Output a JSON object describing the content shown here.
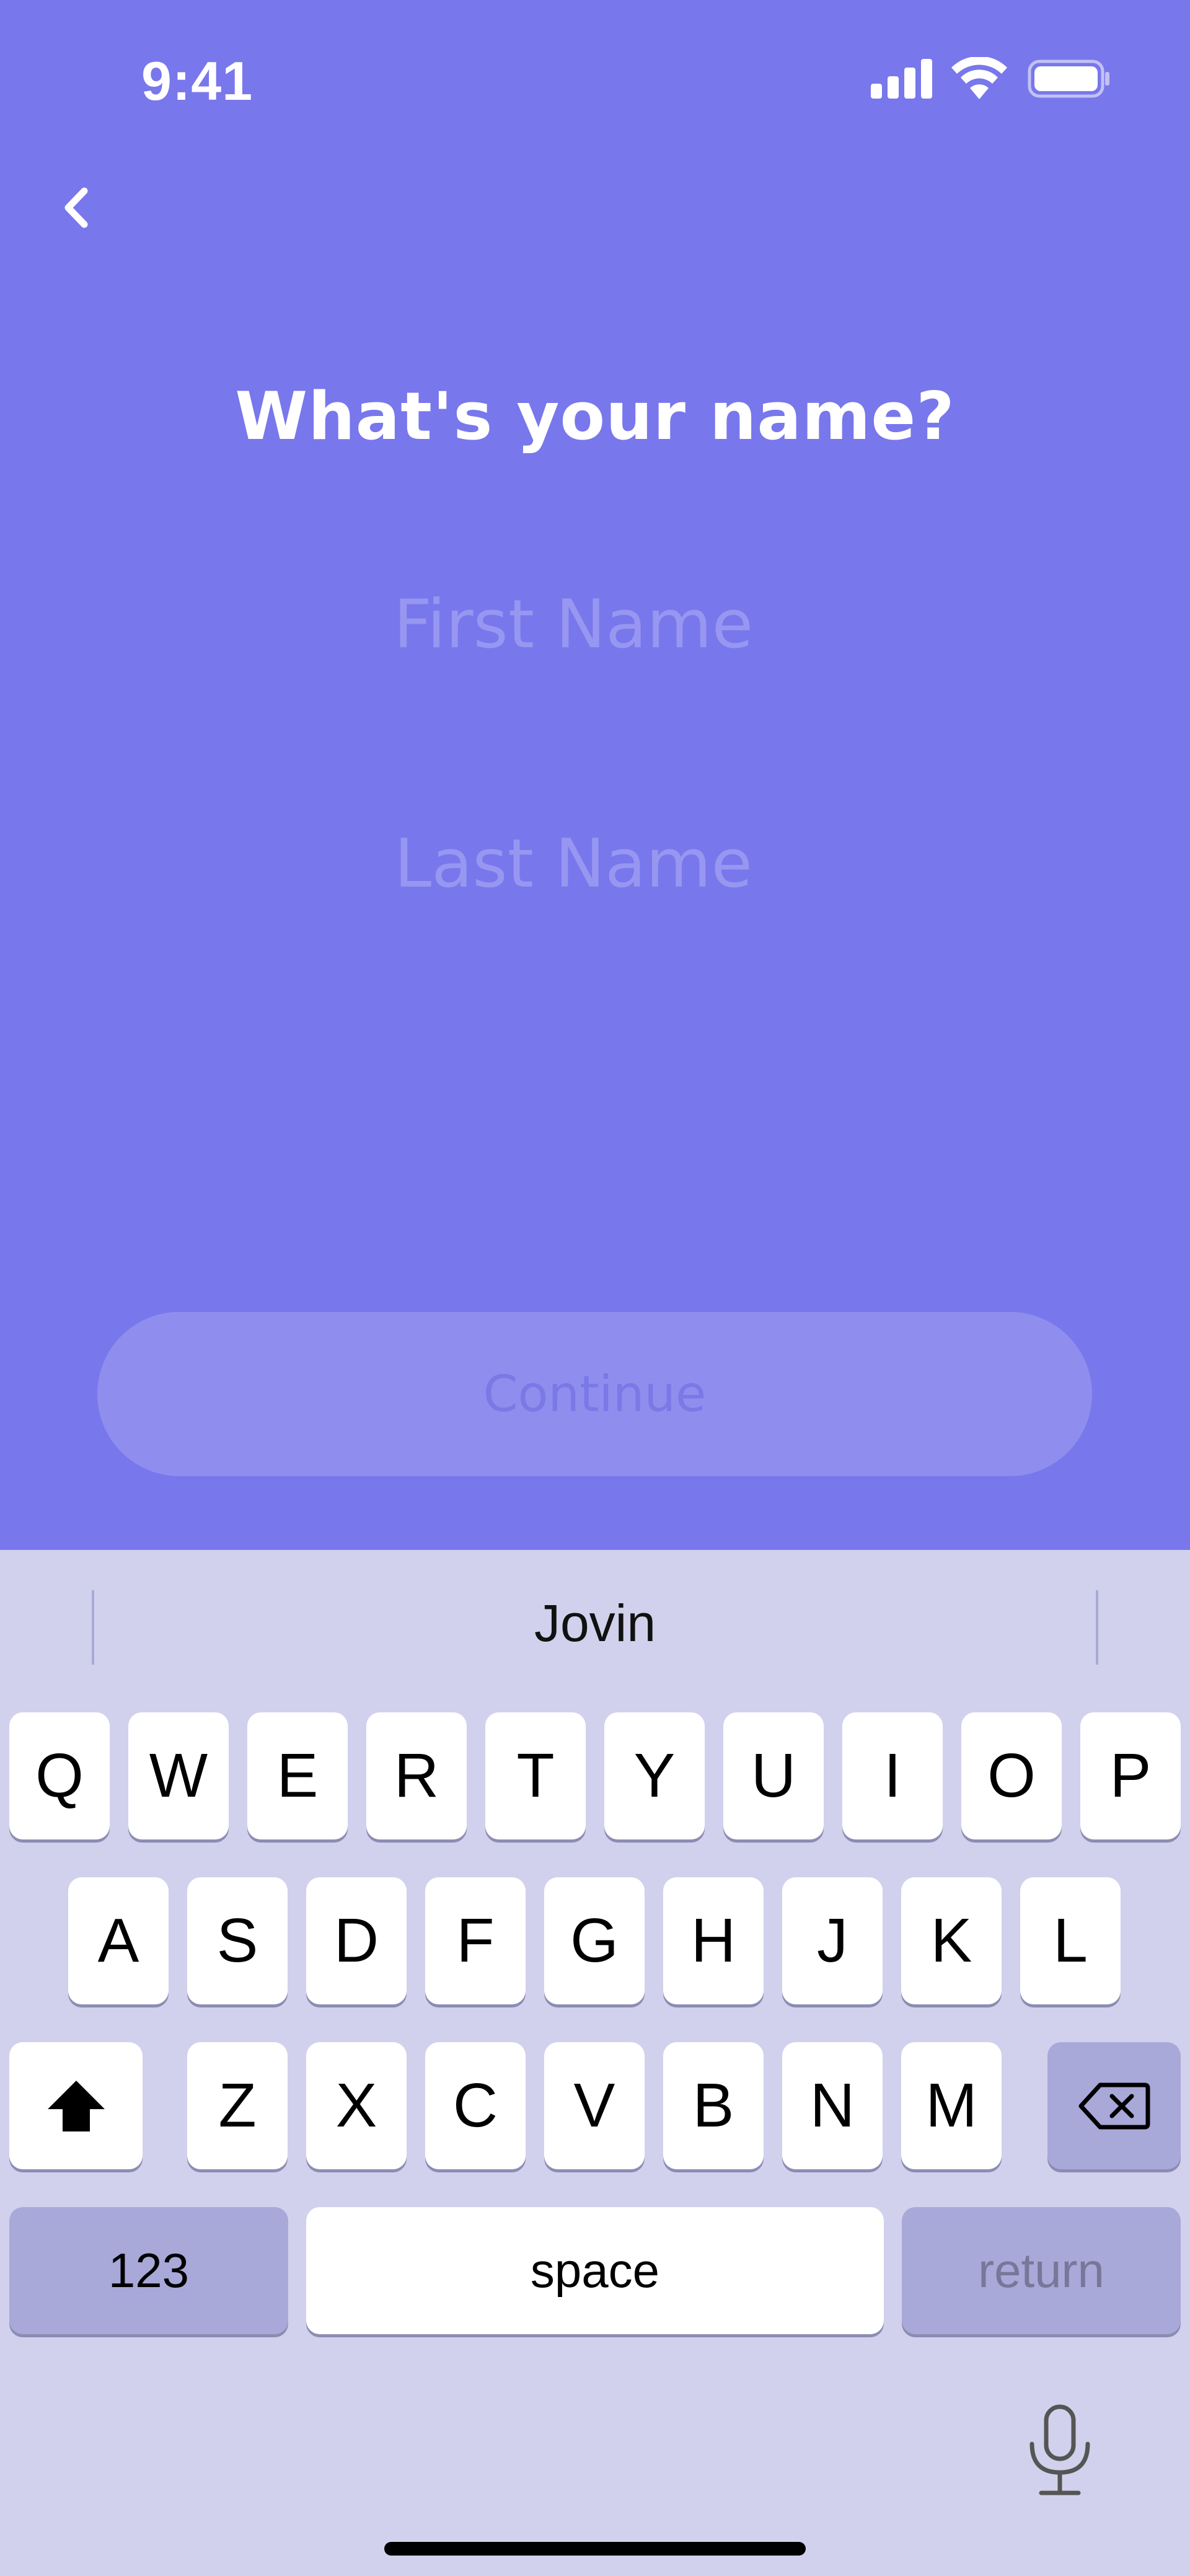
{
  "status_bar": {
    "time": "9:41",
    "icons": [
      "signal-icon",
      "wifi-icon",
      "battery-icon"
    ]
  },
  "nav": {
    "back_icon": "chevron-left-icon"
  },
  "page": {
    "title": "What's your name?",
    "first_name": {
      "value": "",
      "placeholder": "First Name"
    },
    "last_name": {
      "value": "",
      "placeholder": "Last Name"
    },
    "continue_label": "Continue"
  },
  "keyboard": {
    "suggestion": "Jovin",
    "row1": [
      "Q",
      "W",
      "E",
      "R",
      "T",
      "Y",
      "U",
      "I",
      "O",
      "P"
    ],
    "row2": [
      "A",
      "S",
      "D",
      "F",
      "G",
      "H",
      "J",
      "K",
      "L"
    ],
    "row3": [
      "Z",
      "X",
      "C",
      "V",
      "B",
      "N",
      "M"
    ],
    "numbers_label": "123",
    "space_label": "space",
    "return_label": "return",
    "shift_icon": "shift-icon",
    "delete_icon": "delete-icon",
    "mic_icon": "microphone-icon"
  },
  "colors": {
    "background": "#7877ec",
    "keyboard_background": "#d1d1ed",
    "button_disabled": "#8f8eee",
    "placeholder": "#9796f1"
  }
}
